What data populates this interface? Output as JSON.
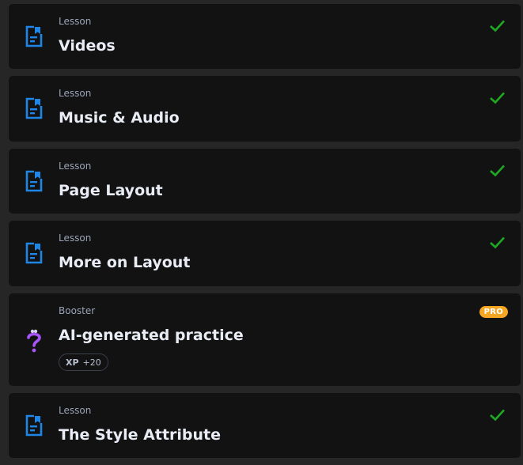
{
  "colors": {
    "background": "#262626",
    "card": "#121212",
    "lesson_icon": "#1e86e6",
    "check": "#1fa823",
    "booster_icon": "#a855f7",
    "pro_badge": "#f5a623"
  },
  "items": [
    {
      "kind": "Lesson",
      "title": "Videos",
      "icon": "lesson-document-icon",
      "completed": true
    },
    {
      "kind": "Lesson",
      "title": "Music & Audio",
      "icon": "lesson-document-icon",
      "completed": true
    },
    {
      "kind": "Lesson",
      "title": "Page Layout",
      "icon": "lesson-document-icon",
      "completed": true
    },
    {
      "kind": "Lesson",
      "title": "More on Layout",
      "icon": "lesson-document-icon",
      "completed": true
    },
    {
      "kind": "Booster",
      "title": "AI-generated practice",
      "icon": "question-mark-icon",
      "badge": "PRO",
      "xp_label": "XP",
      "xp_value": "+20"
    },
    {
      "kind": "Lesson",
      "title": "The Style Attribute",
      "icon": "lesson-document-icon",
      "completed": true
    }
  ]
}
